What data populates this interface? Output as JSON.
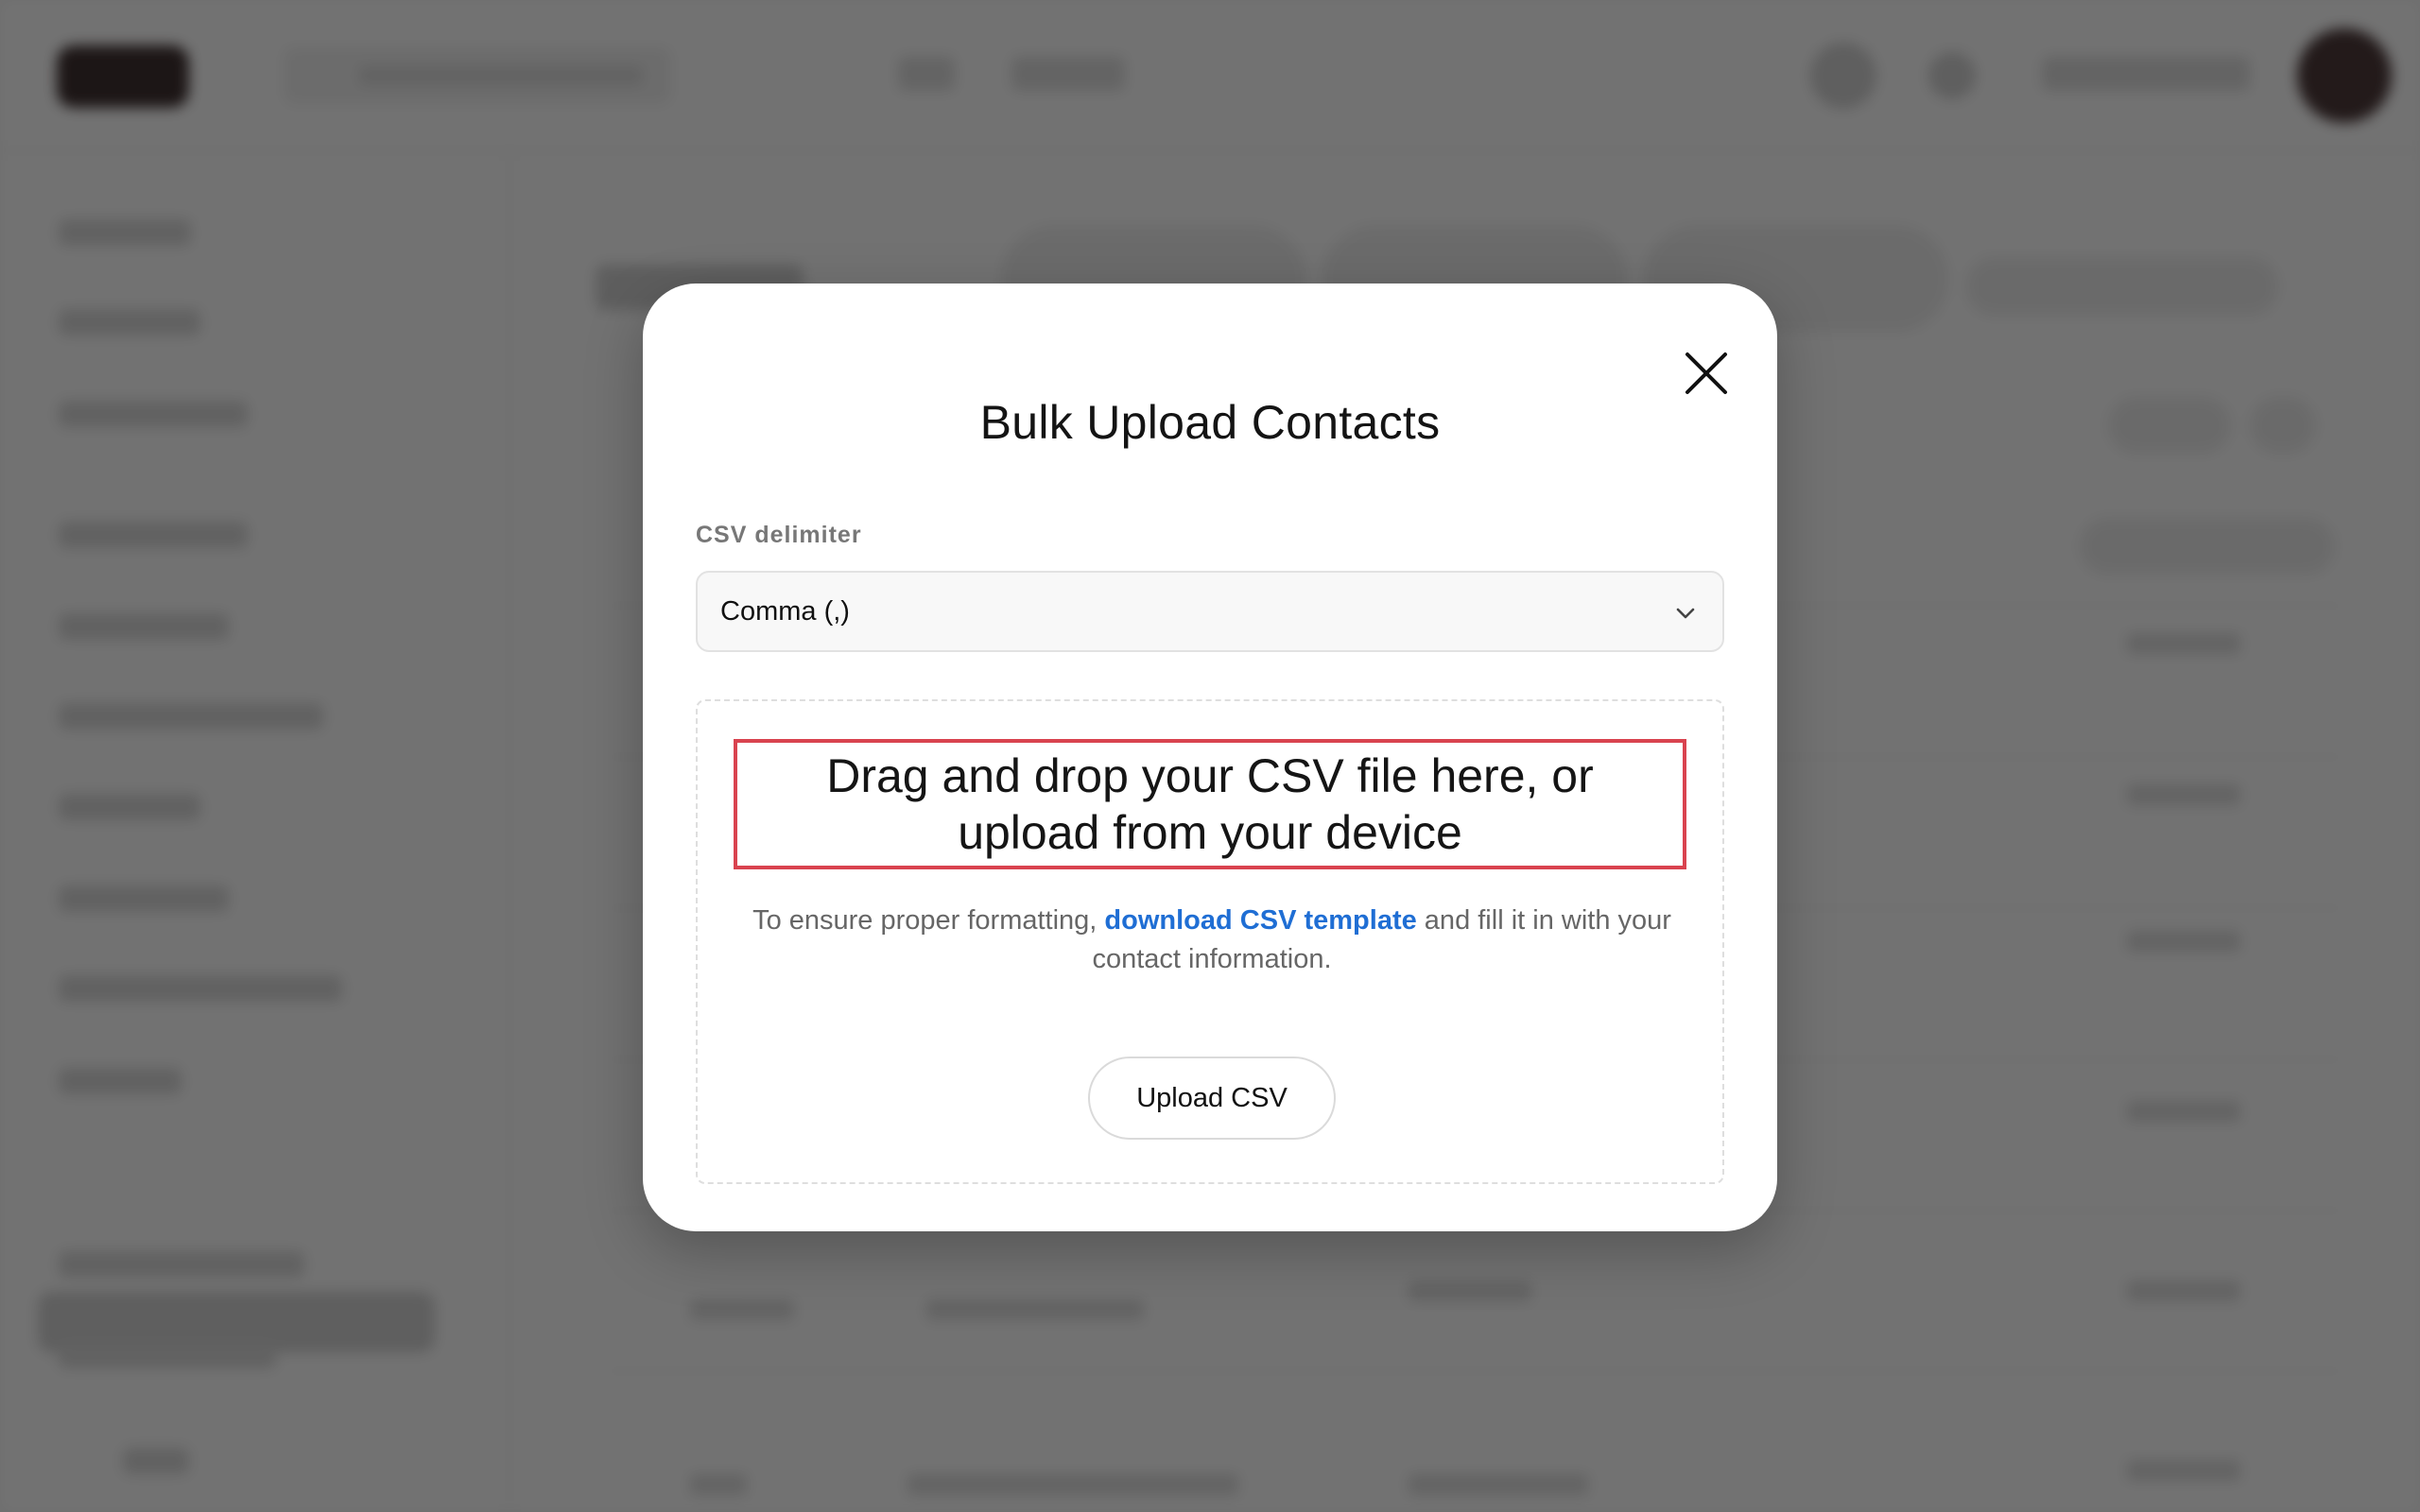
{
  "modal": {
    "title": "Bulk Upload Contacts",
    "close_icon": "close-icon",
    "delimiter": {
      "label": "CSV delimiter",
      "selected": "Comma (,)",
      "chevron_icon": "chevron-down-icon"
    },
    "dropzone": {
      "title": "Drag and drop your CSV file here, or upload from your device",
      "helper_prefix": "To ensure proper formatting, ",
      "helper_link": "download CSV template",
      "helper_suffix": " and fill it in with your contact information.",
      "upload_button": "Upload CSV"
    },
    "highlight_color": "#d9434f",
    "link_color": "#1f6ed4"
  }
}
